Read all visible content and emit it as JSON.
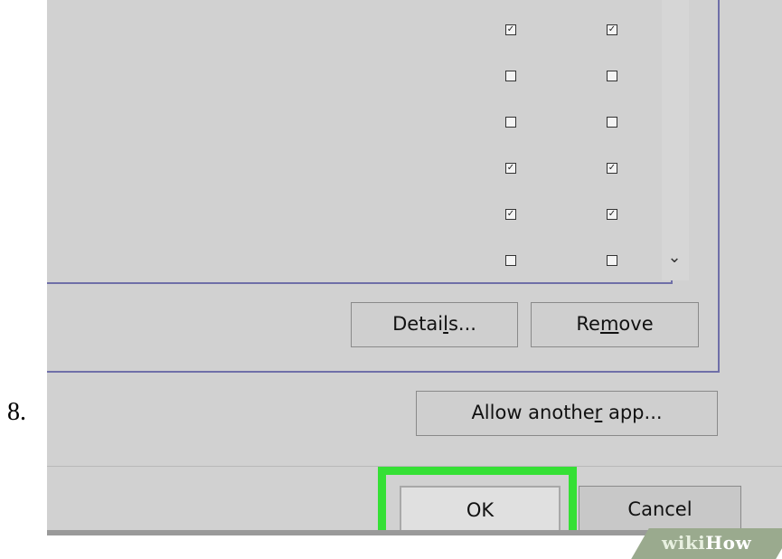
{
  "step_number": "8.",
  "dialog": {
    "checkbox_rows": [
      {
        "col1": true,
        "col2": true
      },
      {
        "col1": false,
        "col2": false
      },
      {
        "col1": false,
        "col2": false
      },
      {
        "col1": true,
        "col2": true
      },
      {
        "col1": true,
        "col2": true
      },
      {
        "col1": false,
        "col2": false
      }
    ],
    "buttons": {
      "details_pre": "Detai",
      "details_u": "l",
      "details_post": "s...",
      "remove_pre": "Re",
      "remove_u": "m",
      "remove_post": "ove",
      "allow_pre": "Allow anothe",
      "allow_u": "r",
      "allow_post": " app...",
      "ok_label": "OK",
      "cancel_label": "Cancel"
    },
    "highlight_color": "#35e035"
  },
  "watermark": {
    "wiki": "wiki",
    "how": "How"
  }
}
